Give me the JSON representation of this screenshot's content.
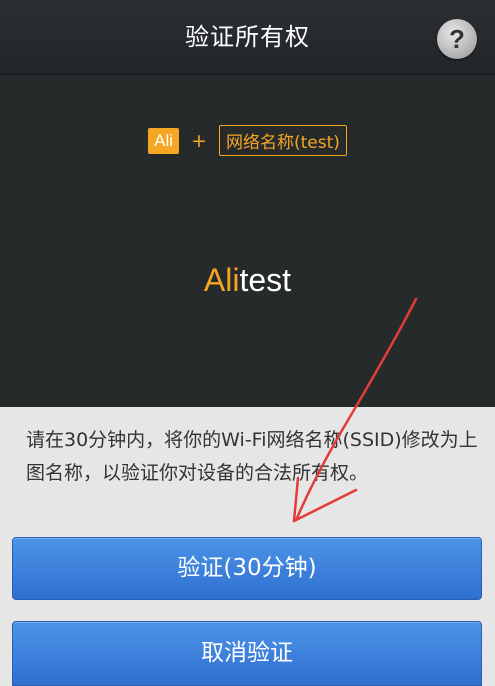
{
  "header": {
    "title": "验证所有权",
    "help_label": "?"
  },
  "formula": {
    "prefix_badge": "Ali",
    "plus": "+",
    "network_badge": "网络名称(test)"
  },
  "ssid_display": {
    "prefix": "Ali",
    "suffix": "test"
  },
  "instructions": "请在30分钟内，将你的Wi-Fi网络名称(SSID)修改为上图名称，以验证你对设备的合法所有权。",
  "buttons": {
    "verify_label": "验证(30分钟)",
    "cancel_label": "取消验证"
  },
  "colors": {
    "accent": "#f5a623",
    "button": "#3b7fdc",
    "annotation": "#e23b3b"
  }
}
